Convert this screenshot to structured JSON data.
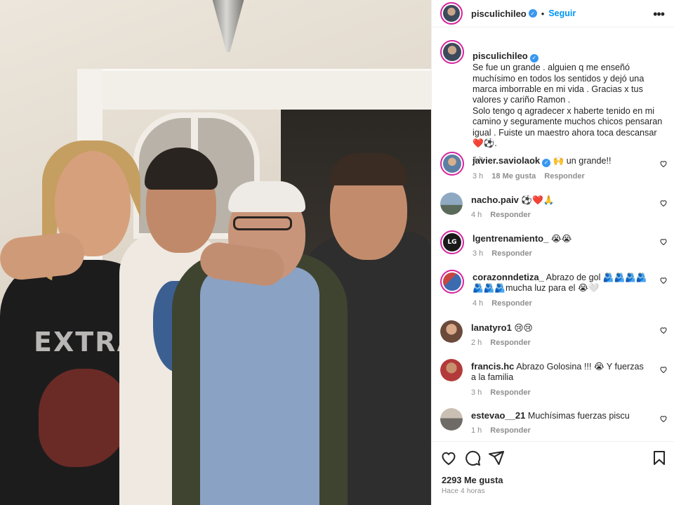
{
  "post": {
    "author": "pisculichileo",
    "follow_label": "Seguir",
    "caption": "Se fue un grande . alguien q me enseñó muchísimo en todos los sentidos y dejó una marca imborrable en mi vida . Gracias x tus valores y cariño Ramon .\nSolo tengo q agradecer x haberte tenido en mi camino y seguramente muchos chicos pensaran igual . Fuiste un maestro ahora toca descansar ❤️⚽.",
    "caption_time": "4 h",
    "likes": "2293 Me gusta",
    "posted_ago": "Hace 4 horas"
  },
  "photo": {
    "shirt_print": "EXTRA"
  },
  "comments": [
    {
      "user": "javier.saviolaok",
      "verified": true,
      "text": "🙌 un grande!!",
      "time": "3 h",
      "likes": "18 Me gusta",
      "reply": "Responder"
    },
    {
      "user": "nacho.paiv",
      "verified": false,
      "text": "⚽❤️🙏",
      "time": "4 h",
      "likes": "",
      "reply": "Responder"
    },
    {
      "user": "lgentrenamiento_",
      "verified": false,
      "text": "😭😭",
      "time": "3 h",
      "likes": "",
      "reply": "Responder"
    },
    {
      "user": "corazonndetiza_",
      "verified": false,
      "text": "Abrazo de gol 🫂🫂🫂🫂🫂🫂🫂mucha luz para el 😭🤍",
      "time": "4 h",
      "likes": "",
      "reply": "Responder"
    },
    {
      "user": "lanatyro1",
      "verified": false,
      "text": "😢😢",
      "time": "2 h",
      "likes": "",
      "reply": "Responder"
    },
    {
      "user": "francis.hc",
      "verified": false,
      "text": "Abrazo Golosina !!! 😭 Y fuerzas a la familia",
      "time": "3 h",
      "likes": "",
      "reply": "Responder"
    },
    {
      "user": "estevao__21",
      "verified": false,
      "text": "Muchísimas fuerzas piscu",
      "time": "1 h",
      "likes": "",
      "reply": "Responder"
    }
  ],
  "icons": {
    "like": "heart-icon",
    "comment": "comment-icon",
    "share": "share-icon",
    "save": "bookmark-icon",
    "more": "more-options-icon",
    "verified": "verified-badge-icon"
  },
  "colors": {
    "accent": "#0095f6",
    "verified": "#3897f0",
    "meta": "#8e8e8e",
    "text": "#262626"
  }
}
